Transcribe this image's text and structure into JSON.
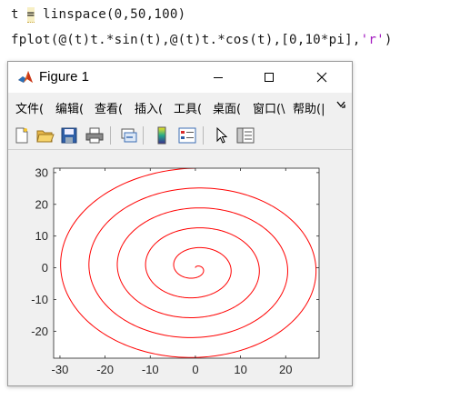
{
  "editor": {
    "line1": {
      "var": "t",
      "eq": "=",
      "rest": "linspace(0,50,100)"
    },
    "line2": {
      "code": "fplot(@(t)t.*sin(t),@(t)t.*cos(t),[0,10*pi],",
      "string": "'r'",
      "close": ")"
    }
  },
  "figure": {
    "title": "Figure 1",
    "icons": {
      "app": "matlab-logo-icon",
      "minimize": "minimize-icon",
      "maximize": "maximize-icon",
      "close": "close-icon"
    },
    "menu": [
      "文件(",
      "编辑(",
      "查看(",
      "插入(",
      "工具(",
      "桌面(",
      "窗口(\\",
      "帮助(|"
    ],
    "menu_more_icon": "chevron-more-icon",
    "toolbar": [
      "new-figure-icon",
      "open-file-icon",
      "save-icon",
      "print-icon",
      "link-plot-icon",
      "colorbar-icon",
      "legend-icon",
      "pointer-icon",
      "property-inspector-icon"
    ]
  },
  "chart_data": {
    "type": "line",
    "title": "",
    "xlabel": "",
    "ylabel": "",
    "xlim": [
      -31.4,
      27.4
    ],
    "ylim": [
      -28.5,
      31.4
    ],
    "xticks": [
      -30,
      -20,
      -10,
      0,
      10,
      20
    ],
    "yticks": [
      -20,
      -10,
      0,
      10,
      20,
      30
    ],
    "grid": false,
    "series": [
      {
        "x_function": "t.*sin(t)",
        "y_function": "t.*cos(t)",
        "t_range": [
          0,
          31.4159
        ],
        "color": "#ff0000"
      }
    ]
  }
}
